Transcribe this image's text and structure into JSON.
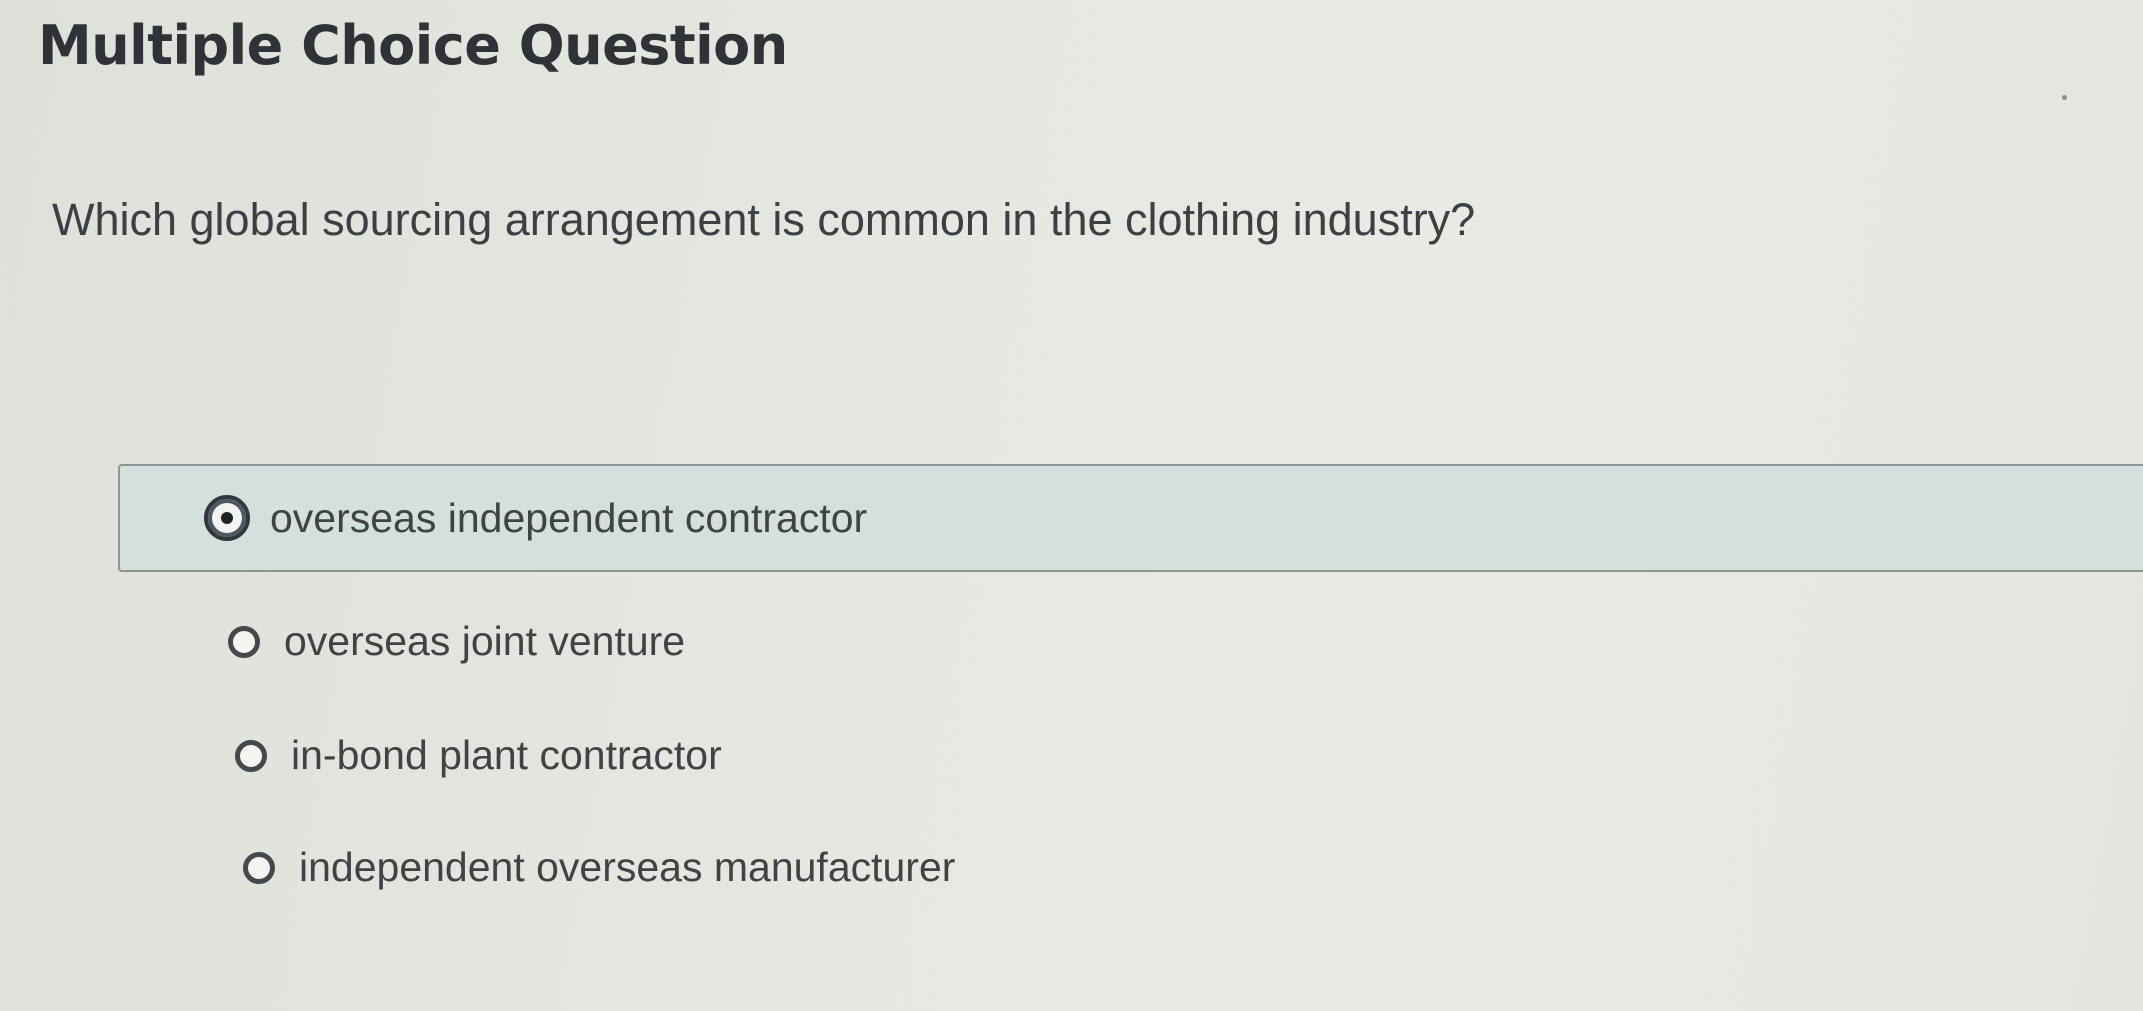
{
  "header": {
    "title": "Multiple Choice Question"
  },
  "question": {
    "text": "Which global sourcing arrangement is common in the clothing industry?"
  },
  "options": [
    {
      "label": "overseas independent contractor",
      "selected": true
    },
    {
      "label": "overseas joint venture",
      "selected": false
    },
    {
      "label": "in-bond plant contractor",
      "selected": false
    },
    {
      "label": "independent overseas manufacturer",
      "selected": false
    }
  ],
  "colors": {
    "background": "#e5e6e0",
    "selected_option_bg": "#d3e0dc",
    "text": "#3a3d40"
  }
}
